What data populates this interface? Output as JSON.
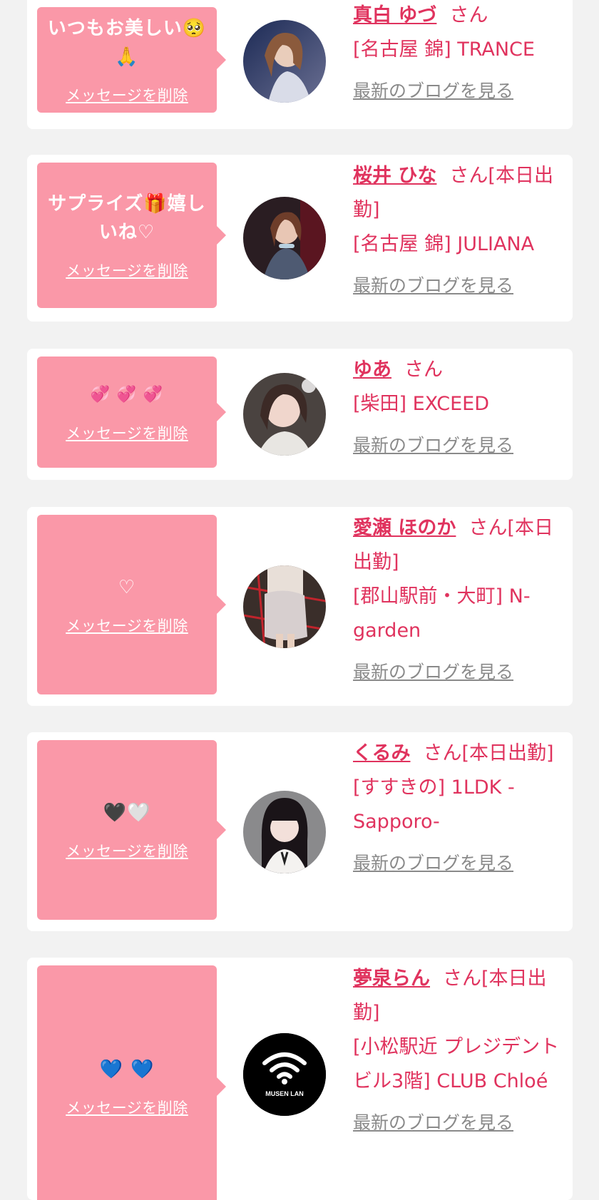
{
  "delete_label": "メッセージを削除",
  "blog_label": "最新のブログを見る",
  "entries": [
    {
      "message": "いつもお美しい🥺🙏",
      "name": "真白 ゆづ",
      "suffix": "さん",
      "shop": "[名古屋 錦] TRANCE"
    },
    {
      "message": "サプライズ🎁嬉しいね♡",
      "name": "桜井 ひな",
      "suffix": "さん[本日出勤]",
      "shop": "[名古屋 錦] JULIANA"
    },
    {
      "message": "💞 💞 💞",
      "name": "ゆあ",
      "suffix": "さん",
      "shop": "[柴田] EXCEED"
    },
    {
      "message": "♡",
      "name": "愛瀬 ほのか",
      "suffix": "さん[本日出勤]",
      "shop": "[郡山駅前・大町] N-garden"
    },
    {
      "message": "🖤🤍",
      "name": "くるみ",
      "suffix": "さん[本日出勤]",
      "shop": "[すすきの] 1LDK -Sapporo-"
    },
    {
      "message": "💙 💙",
      "name": "夢泉らん",
      "suffix": "さん[本日出勤]",
      "shop": "[小松駅近 プレジデントビル3階] CLUB Chloé",
      "avatar_text": "MUSEN LAN"
    }
  ],
  "colors": {
    "accent": "#e0335e",
    "bubble": "#fa98a8",
    "link_gray": "#8a8a8a",
    "background": "#f2f2f2"
  }
}
